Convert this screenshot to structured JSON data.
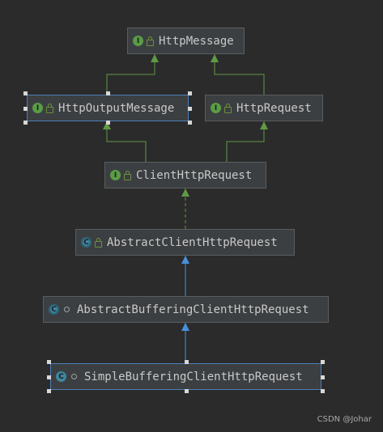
{
  "diagram": {
    "nodes": [
      {
        "id": "HttpMessage",
        "label": "HttpMessage",
        "kind": "interface",
        "badge": "I",
        "modifier": "lock"
      },
      {
        "id": "HttpOutputMessage",
        "label": "HttpOutputMessage",
        "kind": "interface",
        "badge": "I",
        "modifier": "lock",
        "selected": true
      },
      {
        "id": "HttpRequest",
        "label": "HttpRequest",
        "kind": "interface",
        "badge": "I",
        "modifier": "lock"
      },
      {
        "id": "ClientHttpRequest",
        "label": "ClientHttpRequest",
        "kind": "interface",
        "badge": "I",
        "modifier": "lock"
      },
      {
        "id": "AbstractClientHttpRequest",
        "label": "AbstractClientHttpRequest",
        "kind": "abstract-class",
        "badge": "C",
        "modifier": "lock"
      },
      {
        "id": "AbstractBufferingClientHttpRequest",
        "label": "AbstractBufferingClientHttpRequest",
        "kind": "abstract-class",
        "badge": "C",
        "modifier": "package"
      },
      {
        "id": "SimpleBufferingClientHttpRequest",
        "label": "SimpleBufferingClientHttpRequest",
        "kind": "class",
        "badge": "C",
        "modifier": "package",
        "selected": true
      }
    ],
    "edges": [
      {
        "from": "HttpOutputMessage",
        "to": "HttpMessage",
        "type": "extends-interface"
      },
      {
        "from": "HttpRequest",
        "to": "HttpMessage",
        "type": "extends-interface"
      },
      {
        "from": "ClientHttpRequest",
        "to": "HttpOutputMessage",
        "type": "extends-interface"
      },
      {
        "from": "ClientHttpRequest",
        "to": "HttpRequest",
        "type": "extends-interface"
      },
      {
        "from": "AbstractClientHttpRequest",
        "to": "ClientHttpRequest",
        "type": "implements"
      },
      {
        "from": "AbstractBufferingClientHttpRequest",
        "to": "AbstractClientHttpRequest",
        "type": "extends-class"
      },
      {
        "from": "SimpleBufferingClientHttpRequest",
        "to": "AbstractBufferingClientHttpRequest",
        "type": "extends-class"
      }
    ],
    "colors": {
      "background": "#2b2b2b",
      "node_fill": "#3c3f41",
      "node_border": "#5a5d5f",
      "selected_border": "#4b7fb8",
      "interface_edge": "#5f9a45",
      "class_edge": "#4a8fd9",
      "text": "#c9c9c9"
    }
  },
  "watermark": "CSDN @Johar"
}
